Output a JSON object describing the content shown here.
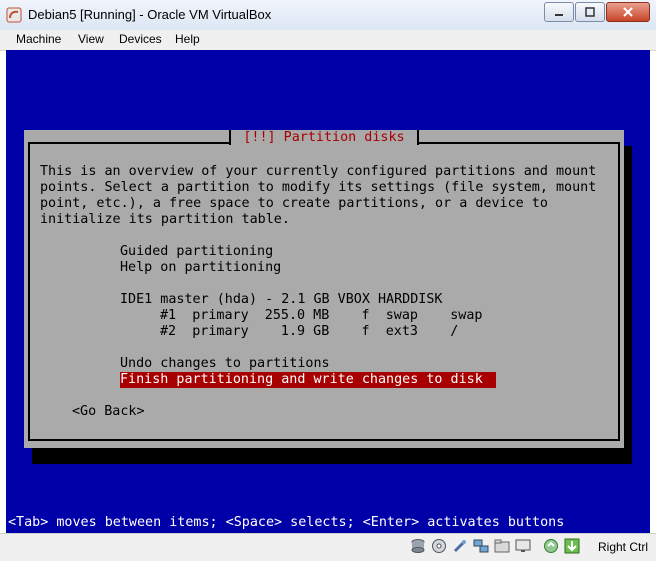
{
  "window": {
    "title": "Debian5 [Running] - Oracle VM VirtualBox",
    "controls": [
      "minimize",
      "maximize",
      "close"
    ]
  },
  "menubar": {
    "items": [
      "Machine",
      "View",
      "Devices",
      "Help"
    ]
  },
  "dialog": {
    "title": "[!!] Partition disks",
    "intro": [
      "This is an overview of your currently configured partitions and mount",
      "points. Select a partition to modify its settings (file system, mount",
      "point, etc.), a free space to create partitions, or a device to",
      "initialize its partition table."
    ],
    "options": {
      "guided": "Guided partitioning",
      "help": "Help on partitioning",
      "disk": "IDE1 master (hda) - 2.1 GB VBOX HARDDISK",
      "partition1": "#1  primary  255.0 MB    f  swap    swap",
      "partition2": "#2  primary    1.9 GB    f  ext3    /",
      "undo": "Undo changes to partitions",
      "finish": "Finish partitioning and write changes to disk"
    },
    "go_back": "<Go Back>"
  },
  "footer": "<Tab> moves between items; <Space> selects; <Enter> activates buttons",
  "statusbar": {
    "icons": [
      "hard-disk-icon",
      "optical-drive-icon",
      "usb-icon",
      "network-icon",
      "shared-folders-icon",
      "display-icon",
      "mouse-integration-icon",
      "host-key-arrow-icon"
    ],
    "host_key": "Right Ctrl"
  },
  "colors": {
    "screen_bg": "#0000a8",
    "dialog_bg": "#aaaaaa",
    "selected_bg": "#a80000",
    "title_fg": "#a80000"
  }
}
